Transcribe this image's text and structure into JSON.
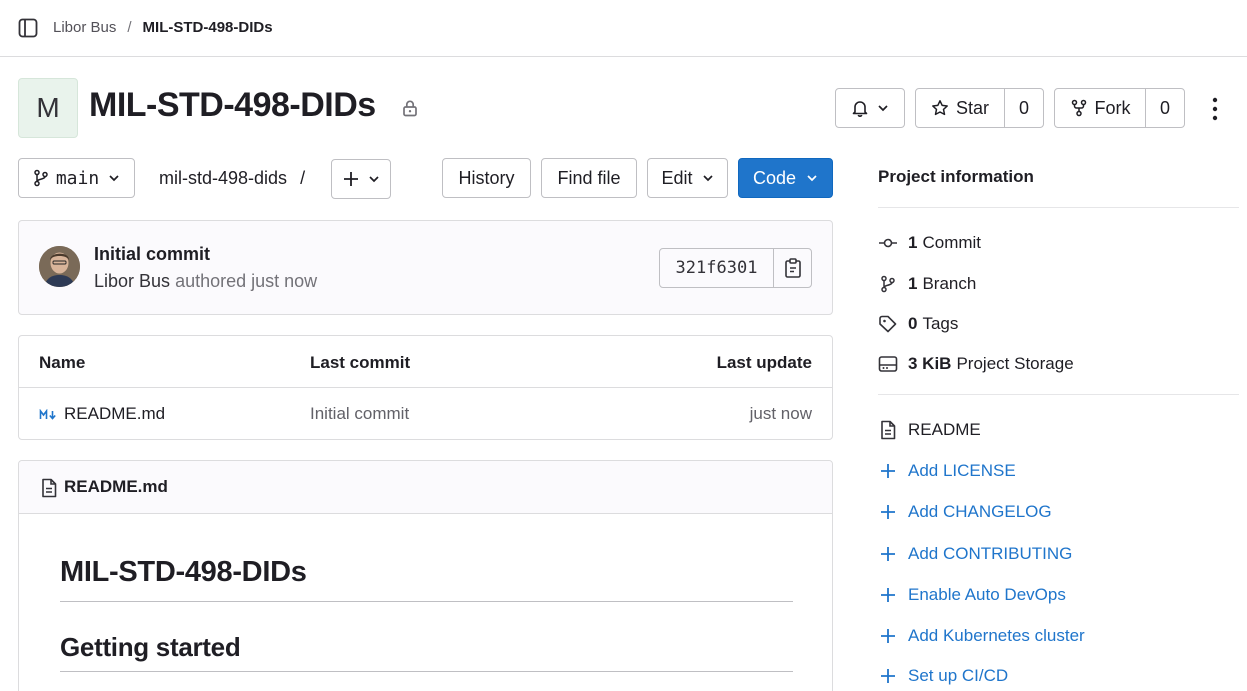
{
  "breadcrumb": {
    "parent": "Libor Bus",
    "separator": "/",
    "current": "MIL-STD-498-DIDs"
  },
  "project": {
    "avatar_letter": "M",
    "title": "MIL-STD-498-DIDs"
  },
  "actions": {
    "star_label": "Star",
    "star_count": "0",
    "fork_label": "Fork",
    "fork_count": "0"
  },
  "toolbar": {
    "branch": "main",
    "path": "mil-std-498-dids",
    "path_sep": "/",
    "history": "History",
    "find_file": "Find file",
    "edit": "Edit",
    "code": "Code"
  },
  "last_commit": {
    "title": "Initial commit",
    "author": "Libor Bus",
    "meta": "authored just now",
    "sha": "321f6301"
  },
  "files": {
    "headers": {
      "name": "Name",
      "last_commit": "Last commit",
      "last_update": "Last update"
    },
    "rows": [
      {
        "name": "README.md",
        "last_commit": "Initial commit",
        "last_update": "just now"
      }
    ]
  },
  "readme": {
    "filename": "README.md",
    "h1": "MIL-STD-498-DIDs",
    "h2": "Getting started"
  },
  "sidebar": {
    "title": "Project information",
    "stats": [
      {
        "count": "1",
        "label": "Commit",
        "icon": "commit-icon"
      },
      {
        "count": "1",
        "label": "Branch",
        "icon": "branch-icon"
      },
      {
        "count": "0",
        "label": "Tags",
        "icon": "tag-icon"
      },
      {
        "count": "3 KiB",
        "label": "Project Storage",
        "icon": "storage-icon"
      }
    ],
    "readme_link": "README",
    "add_links": [
      "Add LICENSE",
      "Add CHANGELOG",
      "Add CONTRIBUTING",
      "Enable Auto DevOps",
      "Add Kubernetes cluster",
      "Set up CI/CD"
    ]
  },
  "colors": {
    "accent": "#1f75cb",
    "border": "#dcdcde",
    "text": "#1f1e24",
    "muted": "#737278"
  }
}
